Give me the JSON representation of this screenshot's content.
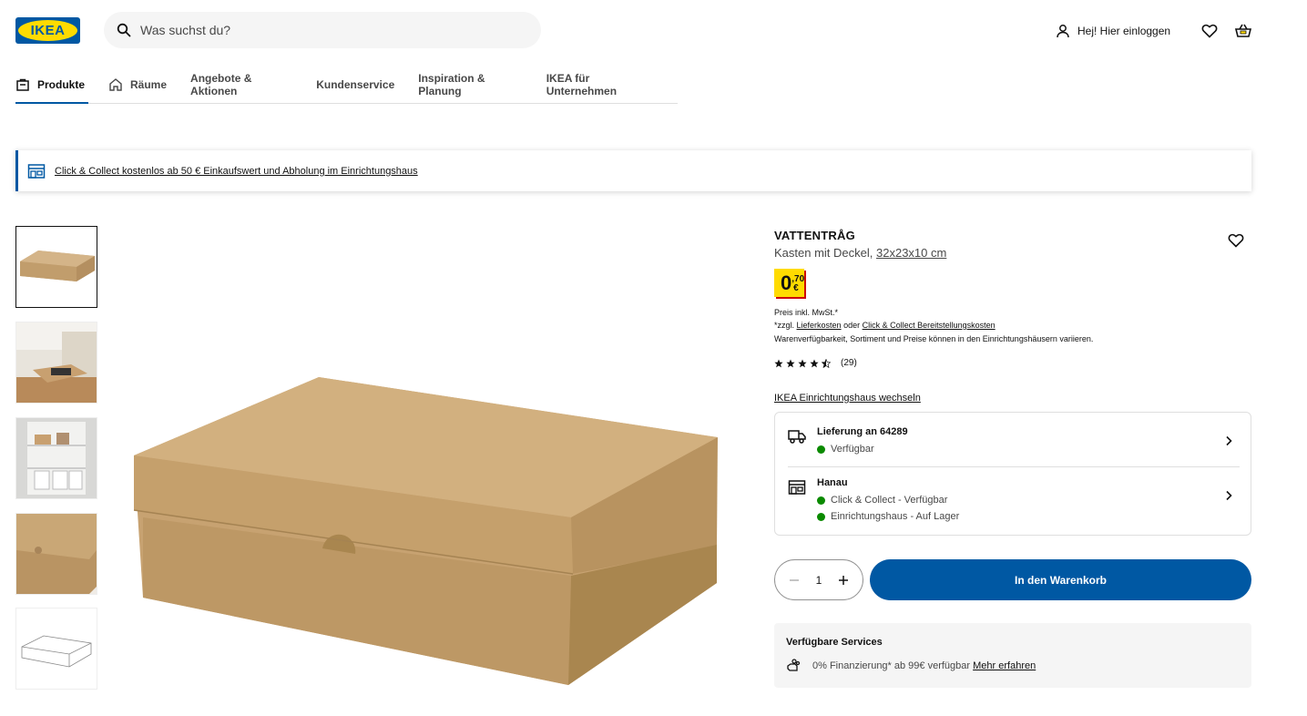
{
  "header": {
    "logo_text": "IKEA",
    "search_placeholder": "Was suchst du?",
    "login_label": "Hej! Hier einloggen"
  },
  "nav": {
    "items": [
      {
        "label": "Produkte",
        "icon": "shopping-bag-icon",
        "active": true
      },
      {
        "label": "Räume",
        "icon": "home-icon",
        "active": false
      },
      {
        "label": "Angebote & Aktionen",
        "active": false
      },
      {
        "label": "Kundenservice",
        "active": false
      },
      {
        "label": "Inspiration & Planung",
        "active": false
      },
      {
        "label": "IKEA für Unternehmen",
        "active": false
      }
    ]
  },
  "banner": {
    "text": "Click & Collect kostenlos ab 50 € Einkaufswert und Abholung im Einrichtungshaus",
    "icon": "store-icon"
  },
  "product": {
    "name": "VATTENTRÅG",
    "description": "Kasten mit Deckel,",
    "dimensions": "32x23x10 cm",
    "price_int": "0",
    "price_dec": ",70",
    "currency": "€",
    "price_note": "Preis inkl. MwSt.*",
    "shipping_prefix": "*zzgl.",
    "shipping_link": "Lieferkosten",
    "shipping_or": "oder",
    "collect_link": "Click & Collect Bereitstellungskosten",
    "availability_note": "Warenverfügbarkeit, Sortiment und Preise können in den Einrichtungshäusern variieren.",
    "rating": 4.5,
    "rating_count": "(29)",
    "thumbnail_count": 5
  },
  "availability": {
    "store_link": "IKEA Einrichtungshaus wechseln",
    "delivery_title": "Lieferung an 64289",
    "delivery_status": "Verfügbar",
    "store_title": "Hanau",
    "collect_status": "Click & Collect - Verfügbar",
    "instore_status": "Einrichtungshaus - Auf Lager",
    "status_color": "#0a8a00"
  },
  "purchase": {
    "quantity": "1",
    "add_to_cart": "In den Warenkorb"
  },
  "services": {
    "title": "Verfügbare Services",
    "financing_text": "0% Finanzierung* ab 99€ verfügbar",
    "financing_link": "Mehr erfahren"
  },
  "colors": {
    "brand_blue": "#0058a3",
    "brand_yellow": "#ffdb00",
    "price_shadow": "#cc0008"
  }
}
